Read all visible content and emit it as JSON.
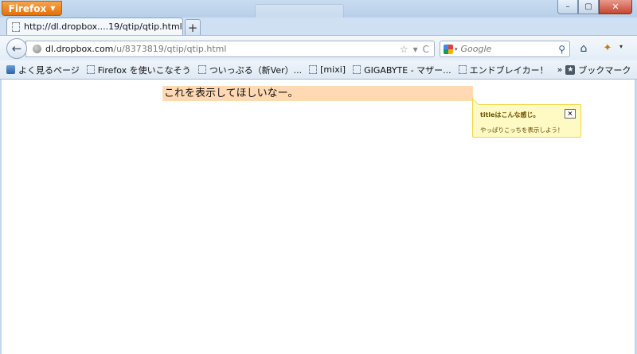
{
  "browser": {
    "menu_button_label": "Firefox",
    "menu_caret": "▼",
    "window_controls": {
      "minimize": "–",
      "maximize": "▢",
      "close": "✕"
    }
  },
  "tabs": [
    {
      "title": "http://dl.dropbox....19/qtip/qtip.html",
      "active": true
    }
  ],
  "new_tab_label": "+",
  "navbar": {
    "back_glyph": "←",
    "url_host": "dl.dropbox.com",
    "url_path": "/u/8373819/qtip/qtip.html",
    "bookmark_star": "☆",
    "dropmarker": "▾",
    "reload_glyph": "C",
    "search_placeholder": "Google",
    "search_caret": "▾",
    "search_glyph": "⚲",
    "home_glyph": "⌂",
    "addon_glyph": "✦",
    "menu_caret": "▾"
  },
  "bookmarks": {
    "items": [
      {
        "label": "よく見るページ"
      },
      {
        "label": "Firefox を使いこなそう"
      },
      {
        "label": "ついっぷる（新Ver）..."
      },
      {
        "label": "[mixi]"
      },
      {
        "label": "GIGABYTE - マザー..."
      },
      {
        "label": "エンドブレイカー！"
      }
    ],
    "overflow": "»",
    "folder_label": "ブックマーク",
    "folder_glyph": "★"
  },
  "content": {
    "target_text": "これを表示してほしいなー。",
    "tooltip": {
      "title": "titleはこんな感じ。",
      "close_label": "×",
      "body": "やっぱりこっちを表示しよう！"
    }
  },
  "colors": {
    "highlight": "#fed9b4",
    "tooltip_bg": "#fff9c4",
    "tooltip_border": "#f1d53f",
    "firefox_orange": "#e2700c"
  }
}
